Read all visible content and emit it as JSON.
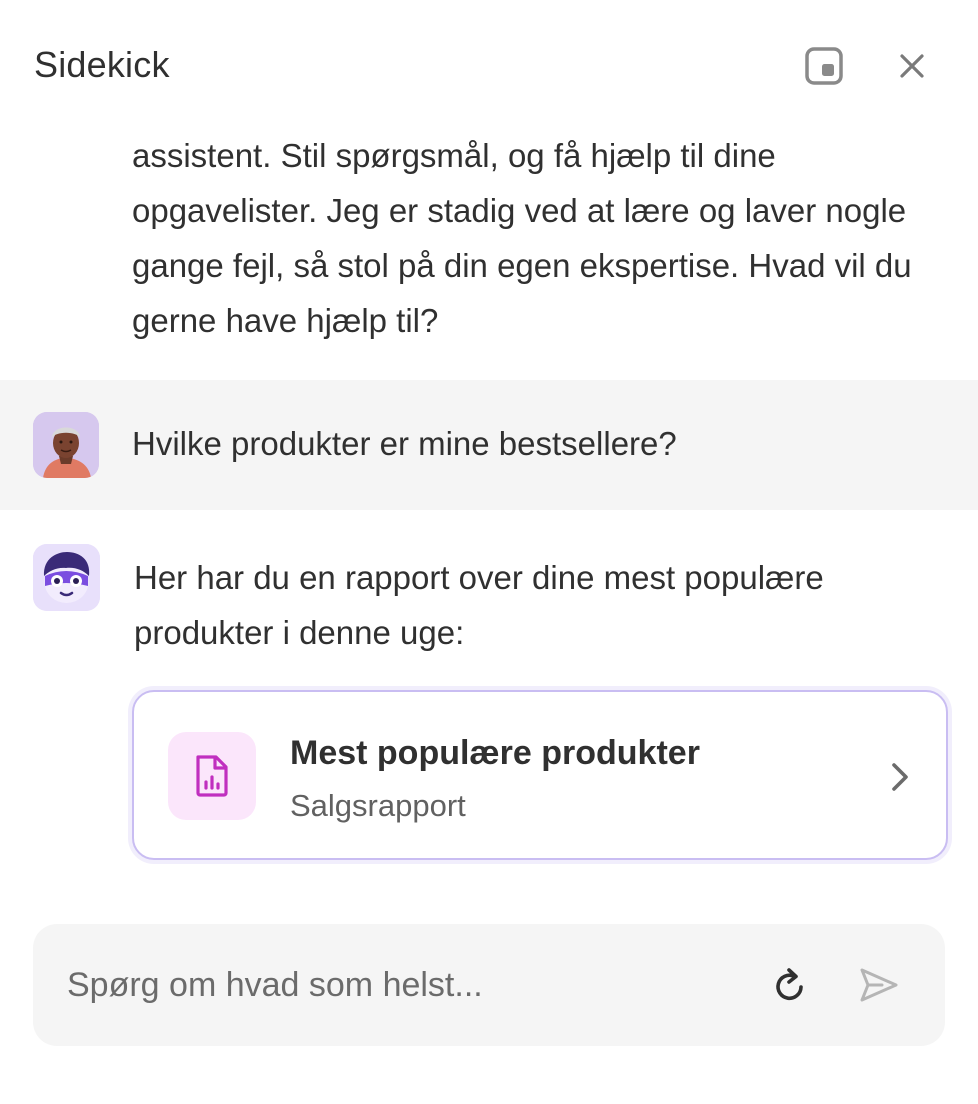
{
  "header": {
    "title": "Sidekick",
    "popout_icon": "popout-window-icon",
    "close_icon": "close-icon"
  },
  "messages": {
    "intro": "assistent. Stil spørgsmål, og få hjælp til dine opgavelister. Jeg er stadig ved at lære og laver nogle gange fejl, så stol på din egen ekspertise. Hvad vil du gerne have hjælp til?",
    "user": "Hvilke produkter er mine bestsellere?",
    "bot": "Her har du en rapport over dine mest populære produkter i denne uge:"
  },
  "report_card": {
    "title": "Mest populære produkter",
    "subtitle": "Salgsrapport",
    "icon": "report-document-icon"
  },
  "composer": {
    "placeholder": "Spørg om hvad som helst...",
    "value": ""
  },
  "colors": {
    "accent_border": "#c9bdf2",
    "report_icon": "#c02fbf",
    "report_icon_bg": "#fbe6fb",
    "bot_avatar_bg": "#e8e0fb",
    "bot_mask": "#7b4de0",
    "user_row_bg": "#f5f5f5"
  }
}
